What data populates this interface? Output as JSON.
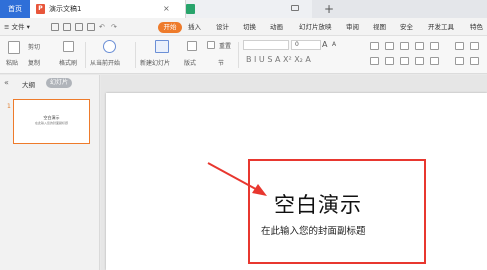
{
  "tabs": {
    "home": "首页",
    "doc_icon": "P",
    "doc_title": "演示文稿1",
    "close": "×",
    "new_tab": "+"
  },
  "menu": {
    "file": "≡ 文件 ▾",
    "start": "开始",
    "items": [
      "插入",
      "设计",
      "切换",
      "动画",
      "幻灯片放映",
      "审阅",
      "视图",
      "安全",
      "开发工具",
      "特色"
    ]
  },
  "ribbon": {
    "cut": "剪切",
    "paste": "粘贴",
    "copy": "复制",
    "format_painter": "格式刷",
    "from_current": "从当前开始",
    "new_slide": "新建幻灯片",
    "layout": "版式",
    "section": "节",
    "reset": "重置",
    "font_size_value": "0",
    "grow_font": "A",
    "shrink_font": "A",
    "format_glyphs": "B  I  U  S  A  X²  X₂  A"
  },
  "leftpanel": {
    "collapse": "«",
    "outline": "大纲",
    "slides": "幻灯片",
    "slide_number": "1",
    "thumb_title": "空白演示",
    "thumb_subtitle": "在此输入您的封面副标题"
  },
  "slide": {
    "title": "空白演示",
    "subtitle": "在此输入您的封面副标题"
  },
  "colors": {
    "accent": "#ee7b2b",
    "home_tab": "#2f6fd8",
    "annotation": "#e8372f"
  }
}
